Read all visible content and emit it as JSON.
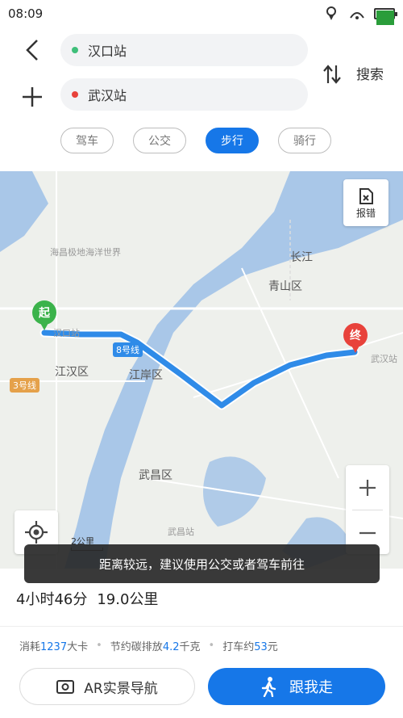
{
  "status": {
    "time": "08:09",
    "icons": [
      "location-icon",
      "notification-icon",
      "battery-icon"
    ]
  },
  "route": {
    "origin": "汉口站",
    "destination": "武汉站",
    "search_label": "搜索",
    "origin_color": "#3fbf7a",
    "destination_color": "#e8423b"
  },
  "modes": [
    {
      "label": "驾车",
      "active": false
    },
    {
      "label": "公交",
      "active": false
    },
    {
      "label": "步行",
      "active": true
    },
    {
      "label": "骑行",
      "active": false
    }
  ],
  "map": {
    "report_label": "报错",
    "scale_label": "2公里",
    "labels": {
      "hankou": "汉口站",
      "jianghan": "江汉区",
      "jiangan": "江岸区",
      "qingshan": "青山区",
      "changjiang": "长江",
      "wuchang": "武昌区",
      "wuhan_station": "武汉站",
      "wuchang_station": "武昌站",
      "hailun": "海昌极地海洋世界"
    },
    "lines": {
      "line8": "8号线",
      "line3": "3号线"
    },
    "pins": {
      "start": "起",
      "end": "终"
    },
    "route_color": "#2f8be8",
    "accent_color": "#1677e8"
  },
  "toast": "距离较远，建议使用公交或者驾车前往",
  "summary": {
    "duration": "4小时46分",
    "distance": "19.0公里",
    "calories_prefix": "消耗",
    "calories_value": "1237",
    "calories_unit": "大卡",
    "carbon_prefix": "节约碳排放",
    "carbon_value": "4.2",
    "carbon_unit": "千克",
    "taxi_prefix": "打车约",
    "taxi_value": "53",
    "taxi_unit": "元"
  },
  "buttons": {
    "ar_nav": "AR实景导航",
    "follow": "跟我走"
  }
}
